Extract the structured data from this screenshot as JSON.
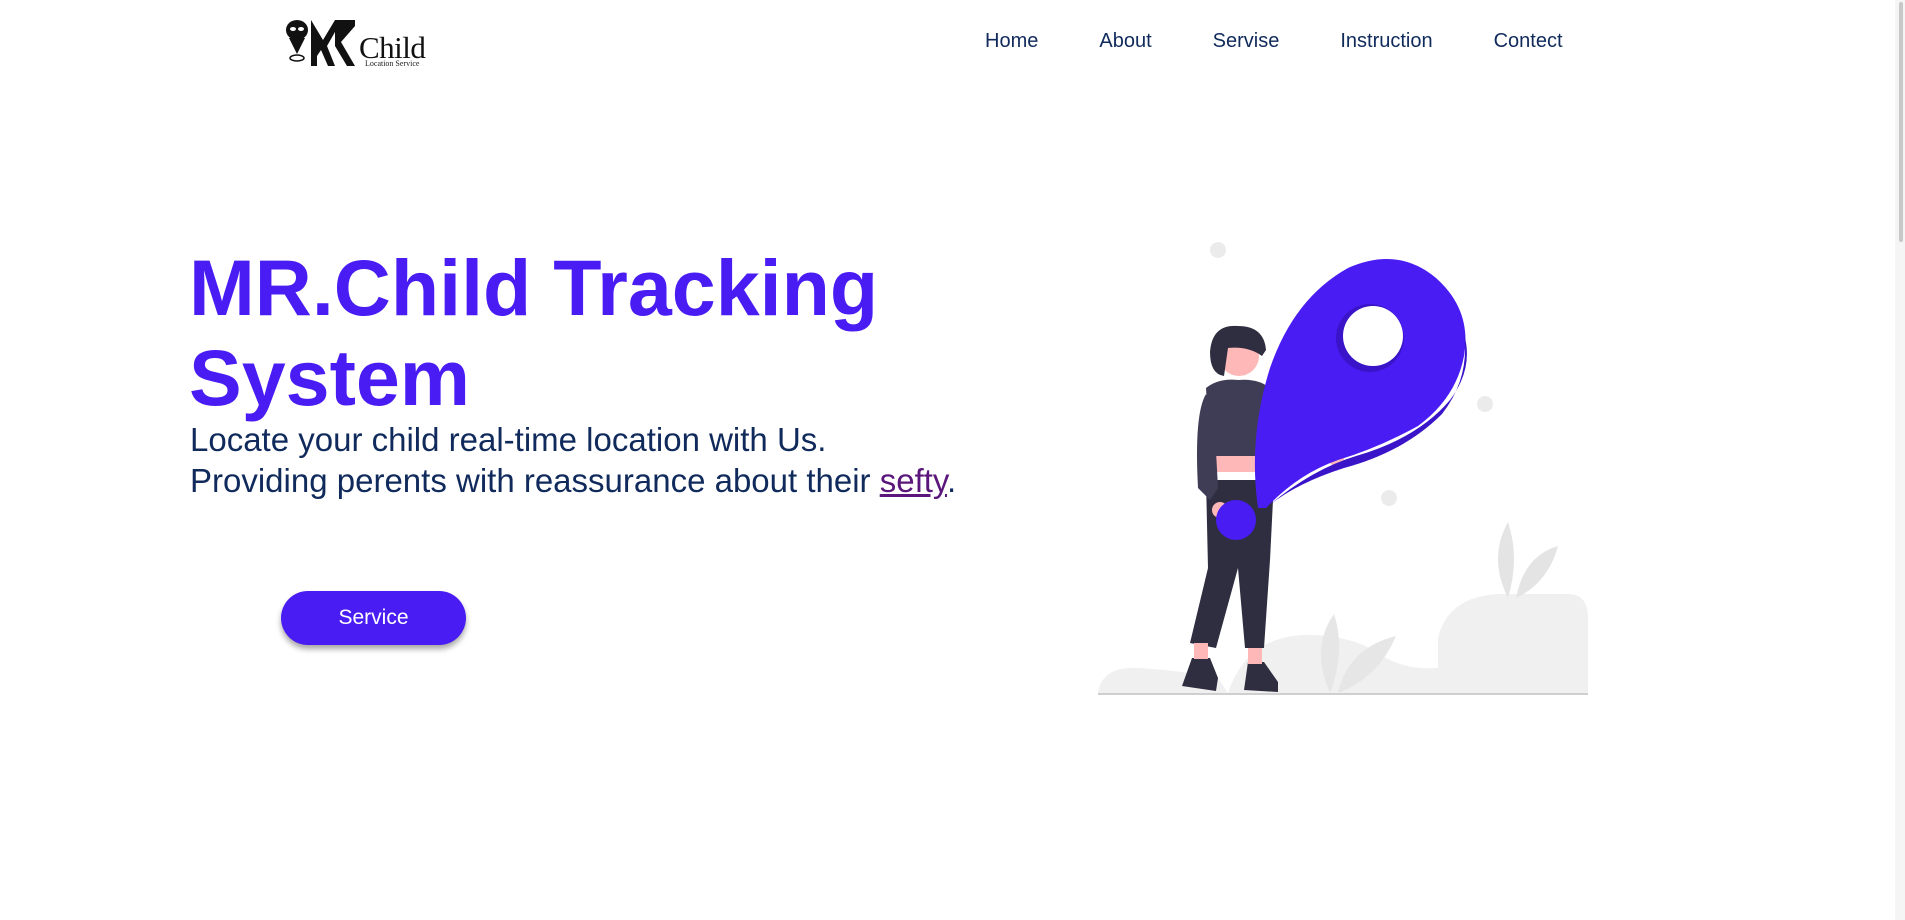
{
  "header": {
    "logo_word": "Child",
    "logo_sub": "Location Service",
    "nav": [
      "Home",
      "About",
      "Servise",
      "Instruction",
      "Contect"
    ]
  },
  "hero": {
    "title": "MR.Child Tracking System",
    "line1": "Locate your child real-time location with Us.",
    "line2_prefix": "Providing perents with reassurance about their ",
    "line2_link": "sefty",
    "line2_suffix": ".",
    "button_label": "Service"
  },
  "colors": {
    "accent": "#4a1cf4",
    "nav_text": "#102a5c",
    "body_text": "#102a5c",
    "link": "#5a167a"
  },
  "icons": {
    "logo": "mr-child-logo-icon",
    "illustration": "woman-with-location-pin-illustration"
  }
}
